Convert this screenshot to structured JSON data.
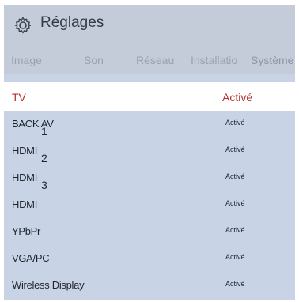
{
  "header": {
    "title": "Réglages",
    "icon": "gear-icon"
  },
  "tabs": [
    {
      "label": "Image"
    },
    {
      "label": "Son"
    },
    {
      "label": "Réseau"
    },
    {
      "label": "Installatio"
    },
    {
      "label": "Système"
    }
  ],
  "selected": {
    "name": "TV",
    "status": "Activé"
  },
  "rows": [
    {
      "name": "BACK AV",
      "sub": "1",
      "status": "Activé"
    },
    {
      "name": "HDMI",
      "sub": "2",
      "status": "Activé"
    },
    {
      "name": "HDMI",
      "sub": "3",
      "status": "Activé"
    },
    {
      "name": "HDMI",
      "sub": "",
      "status": "Activé"
    },
    {
      "name": "YPbPr",
      "sub": "",
      "status": "Activé"
    },
    {
      "name": "VGA/PC",
      "sub": "",
      "status": "Activé"
    },
    {
      "name": "Wireless Display",
      "sub": "",
      "status": "Activé"
    }
  ],
  "colors": {
    "accent": "#b5312c",
    "panel": "#c9d3e6"
  }
}
